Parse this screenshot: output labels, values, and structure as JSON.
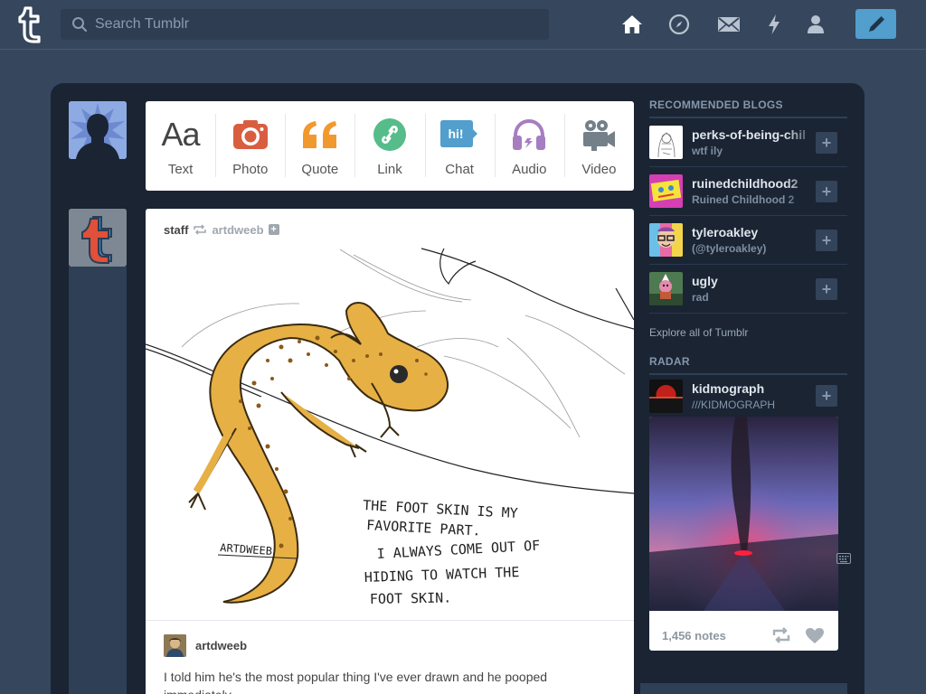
{
  "header": {
    "search_placeholder": "Search Tumblr",
    "nav": [
      "home-icon",
      "explore-icon",
      "inbox-icon",
      "activity-icon",
      "account-icon"
    ],
    "compose_icon": "pencil-icon"
  },
  "post_types": [
    {
      "label": "Text",
      "icon": "text-icon",
      "color": "#444444"
    },
    {
      "label": "Photo",
      "icon": "camera-icon",
      "color": "#d95e40"
    },
    {
      "label": "Quote",
      "icon": "quote-icon",
      "color": "#f2992e"
    },
    {
      "label": "Link",
      "icon": "link-icon",
      "color": "#56bc8a"
    },
    {
      "label": "Chat",
      "icon": "chat-icon",
      "color": "#529ecc"
    },
    {
      "label": "Audio",
      "icon": "headphones-icon",
      "color": "#a77dc2"
    },
    {
      "label": "Video",
      "icon": "video-camera-icon",
      "color": "#748089"
    }
  ],
  "post": {
    "author": "staff",
    "source": "artdweeb",
    "image_caption_lines": [
      "THE FOOT SKIN IS MY",
      "FAVORITE PART.",
      "I ALWAYS COME OUT OF",
      "HIDING TO WATCH THE",
      "FOOT SKIN."
    ],
    "signature": "ARTDWEEB",
    "reblog_author": "artdweeb",
    "body": "I told him he's the most popular thing I've ever drawn and he pooped immediately."
  },
  "sidebar": {
    "recommended_heading": "RECOMMENDED BLOGS",
    "blogs": [
      {
        "name": "perks-of-being-chil",
        "subtitle": "wtf ily"
      },
      {
        "name": "ruinedchildhood2",
        "subtitle": "Ruined Childhood 2"
      },
      {
        "name": "tyleroakley",
        "subtitle": "(@tyleroakley)"
      },
      {
        "name": "ugly",
        "subtitle": "rad"
      }
    ],
    "explore_link": "Explore all of Tumblr",
    "radar_heading": "RADAR",
    "radar": {
      "name": "kidmograph",
      "subtitle": "///KIDMOGRAPH",
      "notes": "1,456 notes"
    }
  },
  "colors": {
    "background": "#36465d",
    "compose_button": "#529ecc",
    "container": "#1a2433"
  }
}
